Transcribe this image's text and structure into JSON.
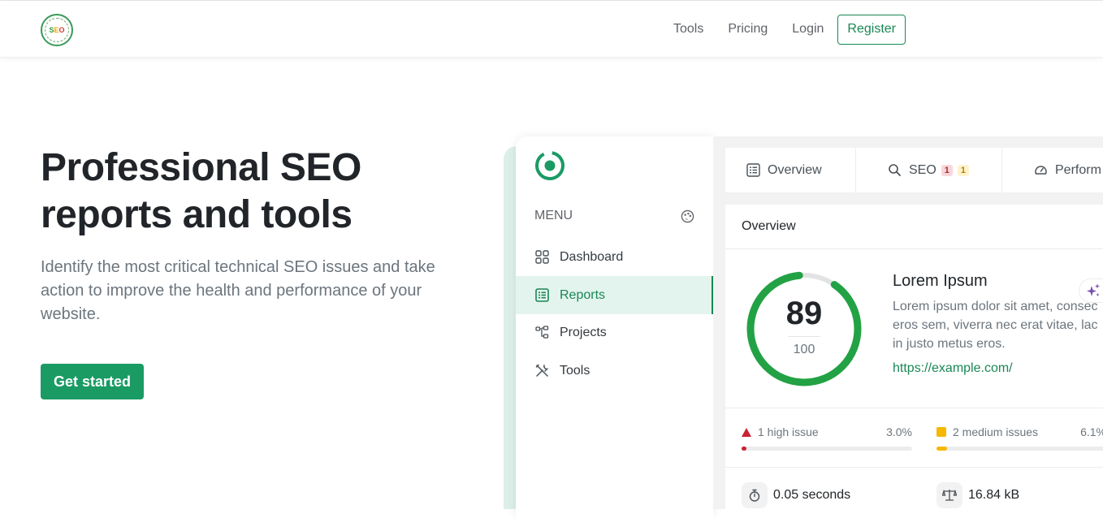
{
  "header": {
    "logo_text": [
      "S",
      "E",
      "O"
    ],
    "nav": [
      {
        "label": "Tools"
      },
      {
        "label": "Pricing"
      },
      {
        "label": "Login"
      }
    ],
    "register_label": "Register"
  },
  "hero": {
    "title_line1": "Professional SEO",
    "title_line2": "reports and tools",
    "subtitle": "Identify the most critical technical SEO issues and take action to improve the health and performance of your website.",
    "cta_label": "Get started"
  },
  "mockup": {
    "sidebar": {
      "menu_label": "MENU",
      "items": [
        {
          "label": "Dashboard",
          "icon": "grid-icon",
          "active": false
        },
        {
          "label": "Reports",
          "icon": "list-report-icon",
          "active": true
        },
        {
          "label": "Projects",
          "icon": "hierarchy-icon",
          "active": false
        },
        {
          "label": "Tools",
          "icon": "tools-icon",
          "active": false
        }
      ]
    },
    "tabs": [
      {
        "label": "Overview",
        "icon": "list-report-icon"
      },
      {
        "label": "SEO",
        "icon": "search-icon",
        "badges": [
          "1",
          "1"
        ]
      },
      {
        "label": "Perform",
        "icon": "gauge-icon"
      }
    ],
    "overview": {
      "header": "Overview",
      "score": "89",
      "score_max": "100",
      "score_fraction": 0.89,
      "site_title": "Lorem Ipsum",
      "desc_lines": [
        "Lorem ipsum dolor sit amet, consec",
        "eros sem, viverra nec erat vitae, lac",
        "in justo metus eros."
      ],
      "url": "https://example.com/",
      "issues": [
        {
          "label": "1 high issue",
          "percent": "3.0%",
          "fraction": 0.03,
          "color": "#c82333"
        },
        {
          "label": "2 medium issues",
          "percent": "6.1%",
          "fraction": 0.061,
          "color": "#f5b800"
        }
      ],
      "stats": [
        {
          "value": "0.05 seconds",
          "icon": "stopwatch-icon"
        },
        {
          "value": "16.84 kB",
          "icon": "scale-icon"
        }
      ]
    }
  },
  "colors": {
    "brand_green": "#198754",
    "cta_green": "#1a9b64",
    "gauge_green": "#22a244",
    "high": "#c82333",
    "medium": "#f5b800",
    "ai_purple": "#7b4fb0"
  }
}
